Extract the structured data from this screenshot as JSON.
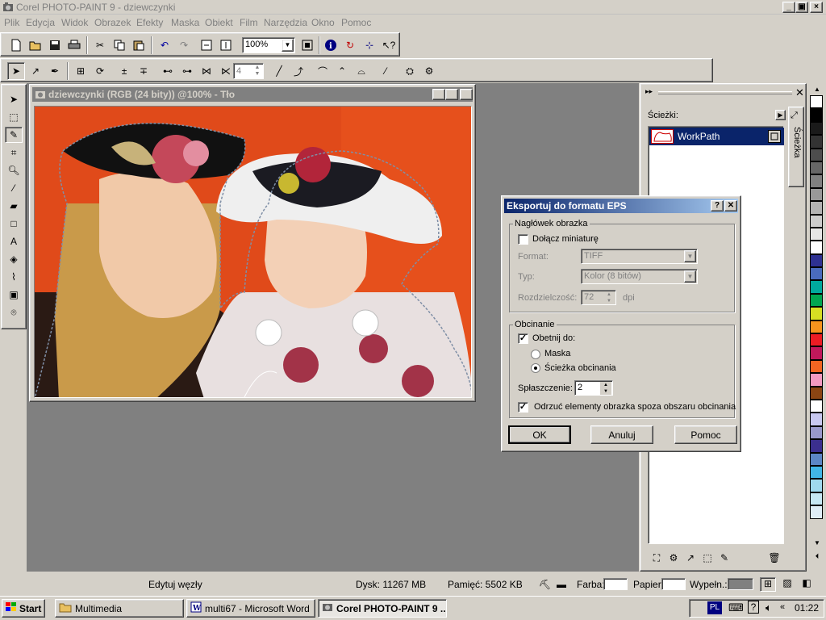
{
  "app": {
    "title": "Corel PHOTO-PAINT 9 - dziewczynki"
  },
  "menu": [
    "Plik",
    "Edycja",
    "Widok",
    "Obrazek",
    "Efekty",
    "Maska",
    "Obiekt",
    "Film",
    "Narzędzia",
    "Okno",
    "Pomoc"
  ],
  "toolbar": {
    "zoom": "100%",
    "brush_size": "4"
  },
  "document": {
    "title": "dziewczynki (RGB (24 bity)) @100% - Tło"
  },
  "panel": {
    "label": "Ścieżki:",
    "path_name": "WorkPath",
    "tab_label": "Ścieżka"
  },
  "dialog": {
    "title": "Eksportuj do formatu EPS",
    "header_group": "Nagłówek obrazka",
    "include_thumb": "Dołącz miniaturę",
    "format_label": "Format:",
    "format_value": "TIFF",
    "type_label": "Typ:",
    "type_value": "Kolor (8 bitów)",
    "resolution_label": "Rozdzielczość:",
    "resolution_value": "72",
    "resolution_unit": "dpi",
    "clip_group": "Obcinanie",
    "clip_to": "Obetnij do:",
    "mask": "Maska",
    "clip_path": "Ścieżka obcinania",
    "flatness_label": "Spłaszczenie:",
    "flatness_value": "2",
    "discard": "Odrzuć elementy obrazka spoza obszaru obcinania",
    "ok": "OK",
    "cancel": "Anuluj",
    "help": "Pomoc",
    "help_q": "?",
    "close_x": "✕"
  },
  "status": {
    "action": "Edytuj węzły",
    "disk": "Dysk: 11267 MB",
    "memory": "Pamięć: 5502 KB",
    "paint": "Farba:",
    "paper": "Papier:",
    "fill": "Wypełn.:"
  },
  "taskbar": {
    "start": "Start",
    "tasks": [
      "Multimedia",
      "multi67 - Microsoft Word",
      "Corel PHOTO-PAINT 9 ..."
    ],
    "lang": "PL",
    "time": "01:22"
  },
  "colors": {
    "palette": [
      "#ffffff",
      "#000000",
      "#1a1a1a",
      "#333333",
      "#4d4d4d",
      "#666666",
      "#808080",
      "#999999",
      "#b3b3b3",
      "#cccccc",
      "#e6e6e6",
      "#ffffff",
      "#2e3192",
      "#4a6bbd",
      "#00a99d",
      "#00a651",
      "#d7df23",
      "#f7941d",
      "#ed1c24",
      "#c2185b",
      "#f26522",
      "#f49ac1",
      "#8b4513",
      "#ffffff",
      "#c8c8f0",
      "#9999cc",
      "#3b2f8f",
      "#5b86c5",
      "#41b6e6",
      "#9fd9ee",
      "#c6e8f4",
      "#dfeef7"
    ]
  }
}
